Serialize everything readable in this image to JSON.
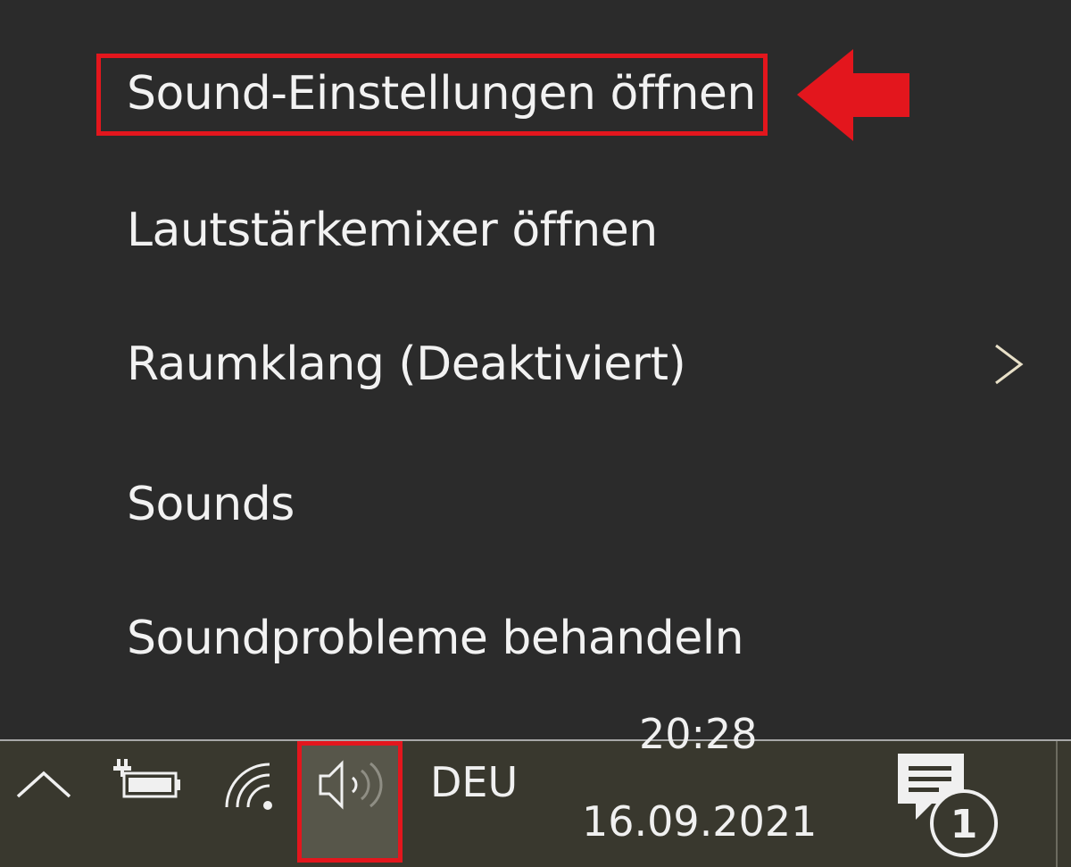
{
  "context_menu": {
    "items": [
      {
        "label": "Sound-Einstellungen öffnen"
      },
      {
        "label": "Lautstärkemixer öffnen"
      },
      {
        "label": "Raumklang (Deaktiviert)"
      },
      {
        "label": "Sounds"
      },
      {
        "label": "Soundprobleme behandeln"
      }
    ]
  },
  "taskbar": {
    "language": "DEU",
    "time": "20:28",
    "date": "16.09.2021",
    "notification_count": "1"
  },
  "annotation": {
    "color": "#e3161d"
  },
  "icons": [
    "chevron-right-icon",
    "show-hidden-icons-caret",
    "battery-icon",
    "wifi-icon",
    "volume-icon",
    "notification-icon"
  ]
}
